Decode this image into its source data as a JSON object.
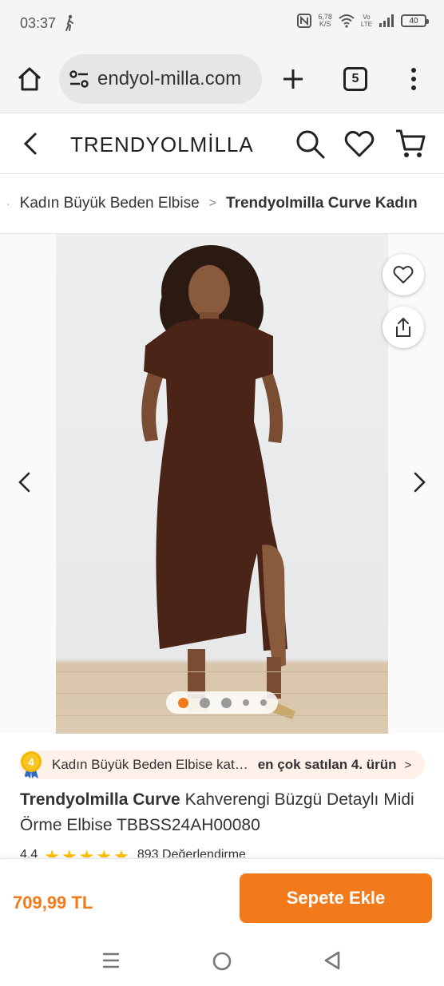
{
  "status_bar": {
    "time": "03:37",
    "net_speed_value": "6,78",
    "net_speed_unit": "K/S",
    "volte_top": "Vo",
    "volte_bottom": "LTE",
    "battery": "40",
    "icons": [
      "walk-icon",
      "nfc-icon",
      "wifi-icon",
      "signal-icon",
      "battery-icon"
    ]
  },
  "browser": {
    "url": "endyol-milla.com",
    "tab_count": "5",
    "icons": [
      "home-icon",
      "tune-icon",
      "plus-icon",
      "more-vertical-icon"
    ]
  },
  "header": {
    "brand": "TRENDYOLMİLLA",
    "icons": [
      "back-icon",
      "search-icon",
      "heart-icon",
      "cart-icon"
    ]
  },
  "breadcrumb": {
    "dot": "·",
    "items": [
      "Kadın Büyük Beden Elbise"
    ],
    "separator": ">",
    "current": "Trendyolmilla Curve Kadın"
  },
  "gallery": {
    "image_count": 5,
    "active_index": 0,
    "colors": {
      "accent": "#f27a1a",
      "dot_inactive": "#9a9a9a",
      "dress": "#4a2416"
    }
  },
  "best_seller": {
    "badge_number": "4",
    "text": "Kadın Büyük Beden Elbise kat…",
    "rank": "en çok satılan 4. ürün",
    "chevron": ">"
  },
  "product": {
    "brand": "Trendyolmilla Curve",
    "title": " Kahverengi Büzgü Detaylı Midi Örme Elbise TBBSS24AH00080",
    "rating_value": "4.4",
    "stars": "★★★★★",
    "review_count": "893 Değerlendirme"
  },
  "bottom_bar": {
    "price": "709,99 TL",
    "add_to_cart": "Sepete Ekle"
  },
  "android_nav": {
    "icons": [
      "recent-apps-icon",
      "home-circle-icon",
      "back-triangle-icon"
    ]
  }
}
